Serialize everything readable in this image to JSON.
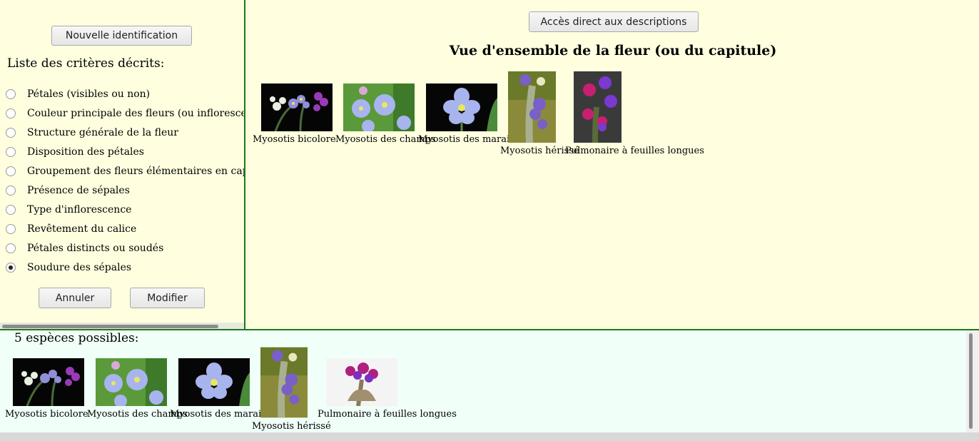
{
  "left_panel": {
    "new_id_button": "Nouvelle identification",
    "criteria_title": "Liste des critères décrits:",
    "criteria": [
      {
        "label": "Pétales (visibles ou non)",
        "selected": false
      },
      {
        "label": "Couleur principale des fleurs (ou inflorescences)",
        "selected": false
      },
      {
        "label": "Structure générale de la fleur",
        "selected": false
      },
      {
        "label": "Disposition des pétales",
        "selected": false
      },
      {
        "label": "Groupement des fleurs élémentaires en capitule ou",
        "selected": false
      },
      {
        "label": "Présence de sépales",
        "selected": false
      },
      {
        "label": "Type d'inflorescence",
        "selected": false
      },
      {
        "label": "Revêtement du calice",
        "selected": false
      },
      {
        "label": "Pétales distincts ou soudés",
        "selected": false
      },
      {
        "label": "Soudure des sépales",
        "selected": true
      }
    ],
    "cancel_button": "Annuler",
    "modify_button": "Modifier"
  },
  "right_panel": {
    "descriptions_button": "Accès direct aux descriptions",
    "view_title": "Vue d'ensemble de la fleur (ou du capitule)",
    "images": [
      {
        "label": "Myosotis bicolore"
      },
      {
        "label": "Myosotis des champs"
      },
      {
        "label": "Myosotis des marais"
      },
      {
        "label": "Myosotis hérissé"
      },
      {
        "label": "Pulmonaire à feuilles longues"
      }
    ]
  },
  "bottom_panel": {
    "species_count": "5 espèces possibles:",
    "species": [
      {
        "label": "Myosotis bicolore"
      },
      {
        "label": "Myosotis des champs"
      },
      {
        "label": "Myosotis des marais"
      },
      {
        "label": "Myosotis hérissé"
      },
      {
        "label": "Pulmonaire à feuilles longues"
      }
    ]
  },
  "colors": {
    "panel_bg": "#ffffe0",
    "bottom_bg": "#f0fff8",
    "divider": "#1a7a1a"
  }
}
